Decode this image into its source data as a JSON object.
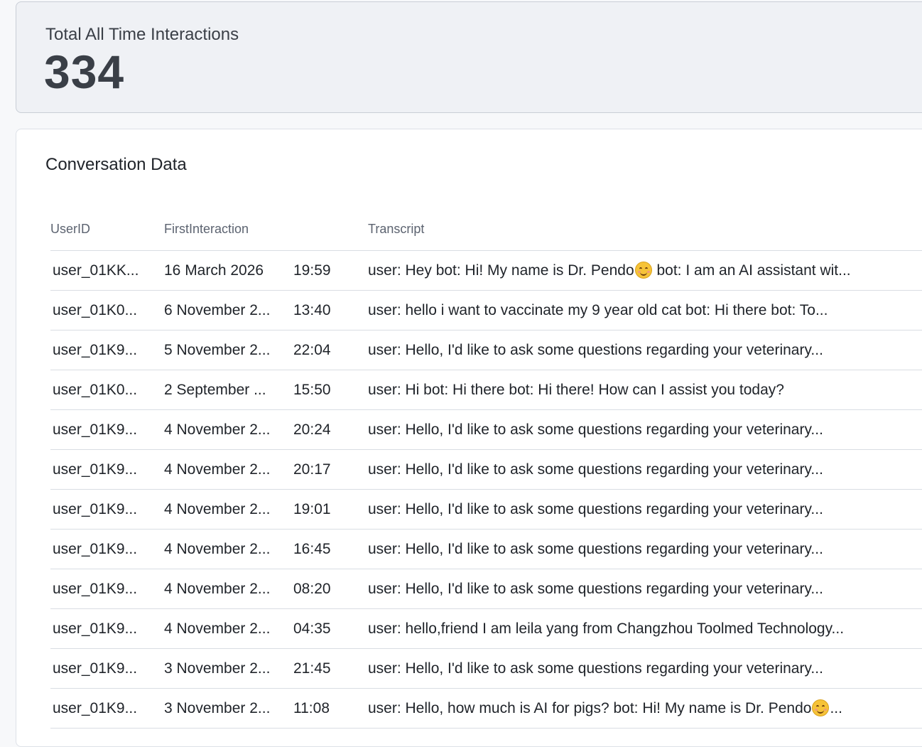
{
  "stats": {
    "label": "Total All Time Interactions",
    "value": "334"
  },
  "conversations": {
    "title": "Conversation Data",
    "columns": {
      "user": "UserID",
      "first": "FirstInteraction",
      "transcript": "Transcript"
    },
    "rows": [
      {
        "user": "user_01KK...",
        "date": "16 March 2026",
        "time": "19:59",
        "t1": "user: Hey bot: Hi! My name is Dr. Pendo",
        "emoji": "smiling-face-icon",
        "t2": " bot: I am an AI assistant wit..."
      },
      {
        "user": "user_01K0...",
        "date": "6 November 2...",
        "time": "13:40",
        "t1": "user: hello i want to vaccinate my 9 year old cat bot: Hi there bot: To..."
      },
      {
        "user": "user_01K9...",
        "date": "5 November 2...",
        "time": "22:04",
        "t1": "user: Hello, I'd like to ask some questions regarding your veterinary..."
      },
      {
        "user": "user_01K0...",
        "date": "2 September ...",
        "time": "15:50",
        "t1": "user: Hi bot: Hi there bot: Hi there! How can I assist you today?"
      },
      {
        "user": "user_01K9...",
        "date": "4 November 2...",
        "time": "20:24",
        "t1": "user: Hello, I'd like to ask some questions regarding your veterinary..."
      },
      {
        "user": "user_01K9...",
        "date": "4 November 2...",
        "time": "20:17",
        "t1": "user: Hello, I'd like to ask some questions regarding your veterinary..."
      },
      {
        "user": "user_01K9...",
        "date": "4 November 2...",
        "time": "19:01",
        "t1": "user: Hello, I'd like to ask some questions regarding your veterinary..."
      },
      {
        "user": "user_01K9...",
        "date": "4 November 2...",
        "time": "16:45",
        "t1": "user: Hello, I'd like to ask some questions regarding your veterinary..."
      },
      {
        "user": "user_01K9...",
        "date": "4 November 2...",
        "time": "08:20",
        "t1": "user: Hello, I'd like to ask some questions regarding your veterinary..."
      },
      {
        "user": "user_01K9...",
        "date": "4 November 2...",
        "time": "04:35",
        "t1": "user: hello,friend I am leila yang from Changzhou Toolmed Technology..."
      },
      {
        "user": "user_01K9...",
        "date": "3 November 2...",
        "time": "21:45",
        "t1": "user: Hello, I'd like to ask some questions regarding your veterinary..."
      },
      {
        "user": "user_01K9...",
        "date": "3 November 2...",
        "time": "11:08",
        "t1": "user: Hello, how much is AI for pigs? bot: Hi! My name is Dr. Pendo",
        "emoji": "smiling-face-icon",
        "t2": "..."
      }
    ]
  }
}
